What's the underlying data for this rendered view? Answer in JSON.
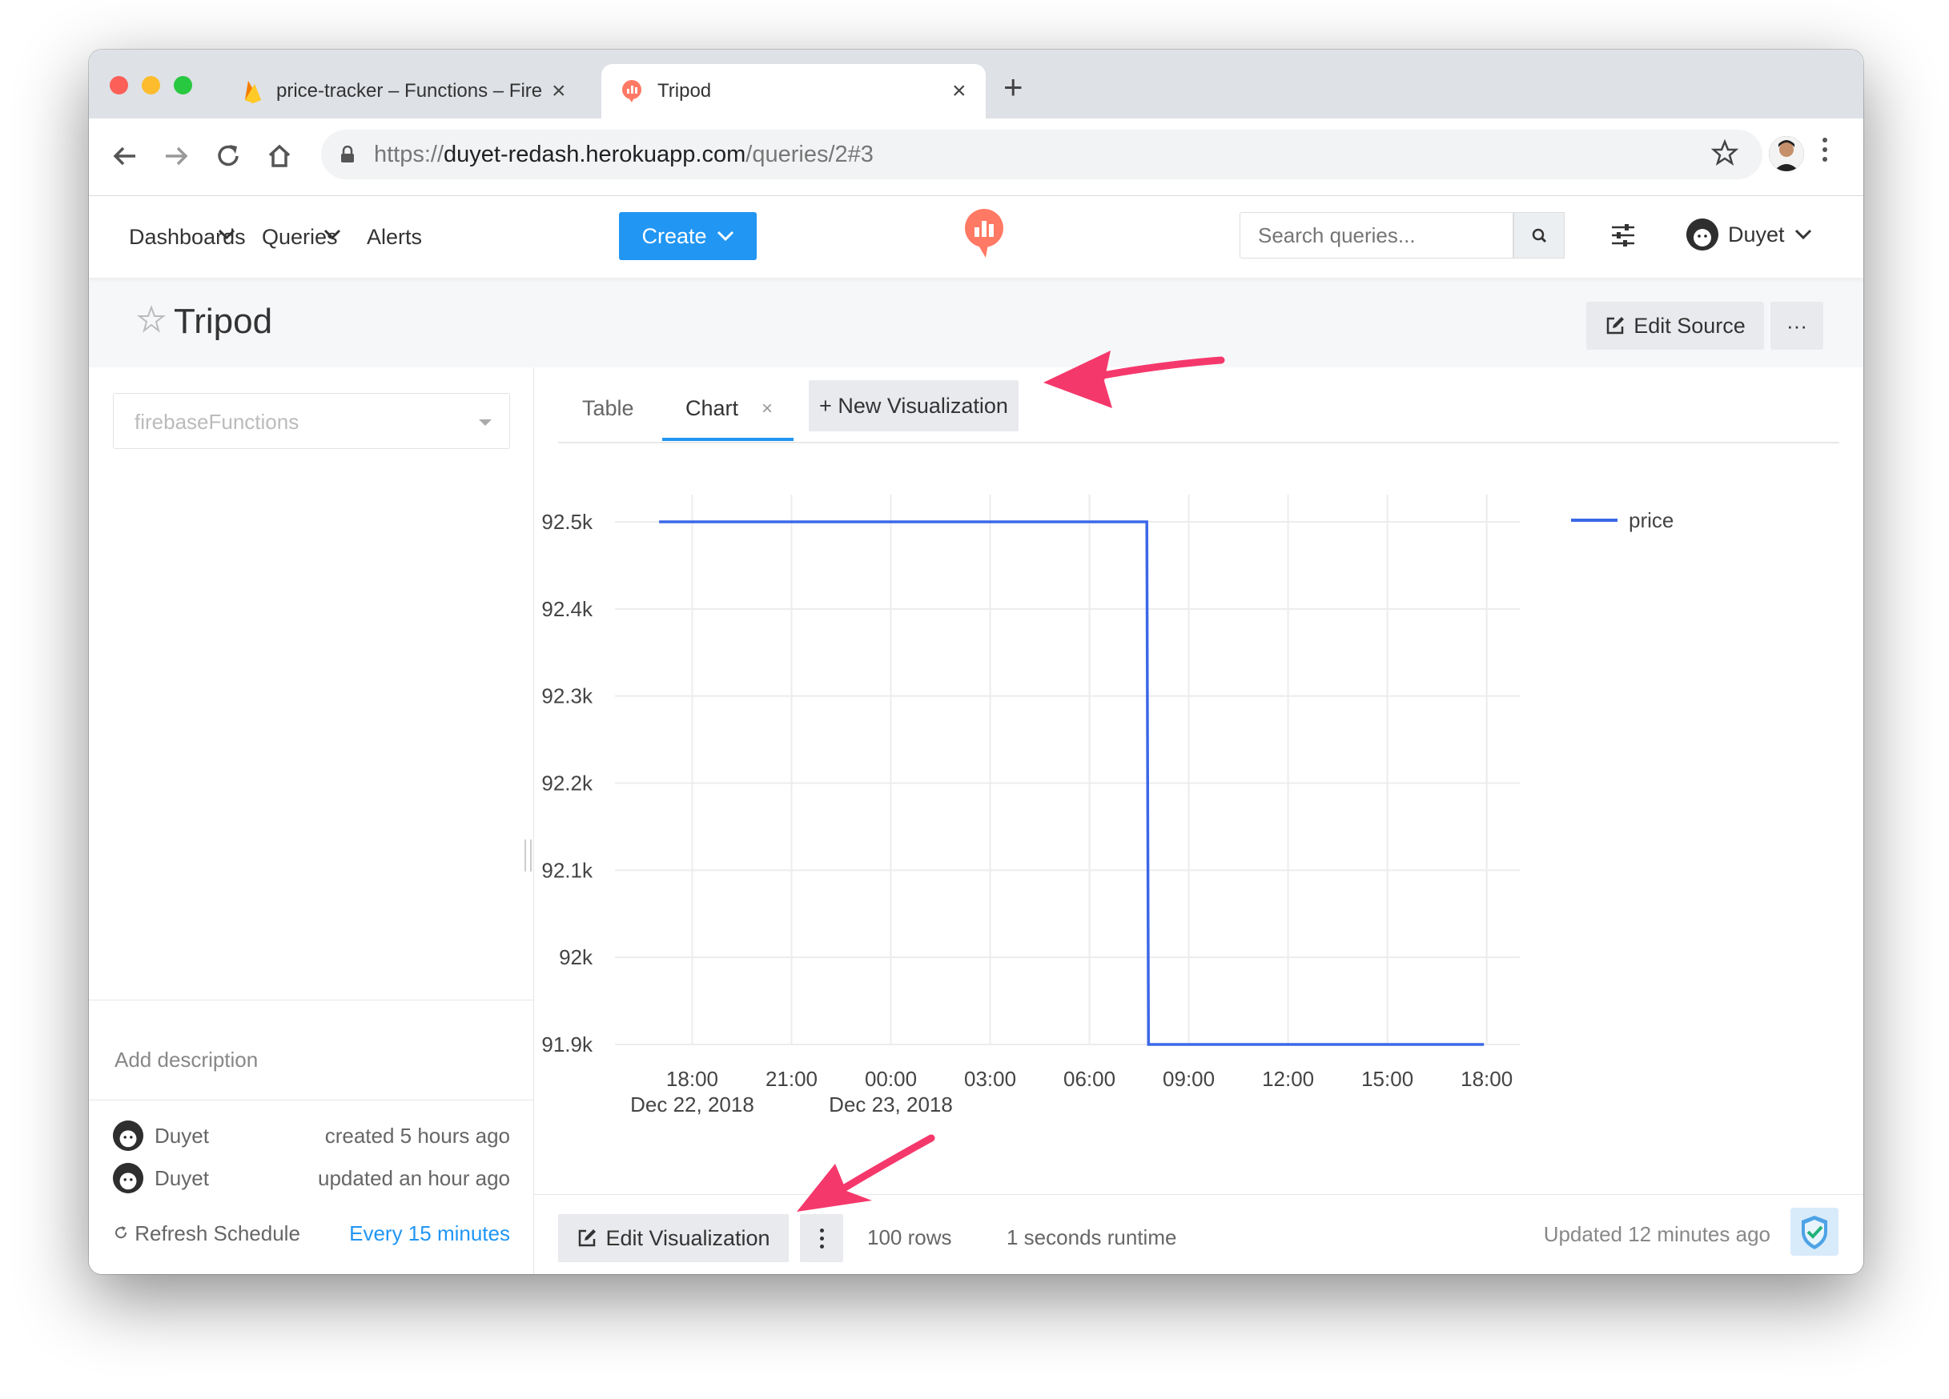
{
  "browser": {
    "tabs": [
      {
        "title": "price-tracker – Functions – Fire",
        "close": "×"
      },
      {
        "title": "Tripod",
        "close": "×"
      }
    ],
    "new_tab": "+",
    "url_scheme": "https://",
    "url_host": "duyet-redash.herokuapp.com",
    "url_path": "/queries/2#3"
  },
  "header": {
    "nav": [
      {
        "label": "Dashboards"
      },
      {
        "label": "Queries"
      },
      {
        "label": "Alerts"
      }
    ],
    "create_label": "Create",
    "search_placeholder": "Search queries...",
    "user_name": "Duyet"
  },
  "query": {
    "title": "Tripod",
    "edit_source_label": "Edit Source",
    "more_label": "···"
  },
  "sidebar": {
    "data_source": "firebaseFunctions",
    "add_description": "Add description",
    "created_by": "Duyet",
    "created_text": "created 5 hours ago",
    "updated_by": "Duyet",
    "updated_text": "updated an hour ago",
    "refresh_label": "Refresh Schedule",
    "refresh_value": "Every 15 minutes"
  },
  "viz_tabs": {
    "table": "Table",
    "chart": "Chart",
    "chart_close": "×",
    "new_viz": "+ New Visualization"
  },
  "footer": {
    "edit_viz_label": "Edit Visualization",
    "rows_text": "100 rows",
    "runtime_text": "1 seconds runtime",
    "updated_text": "Updated 12 minutes ago"
  },
  "colors": {
    "accent": "#2196f3",
    "series": "#3b68e8",
    "arrow": "#f5386b",
    "logo": "#ff7964"
  },
  "chart_data": {
    "type": "line",
    "series": [
      {
        "name": "price",
        "x": [
          "2018-12-22 17:00",
          "2018-12-23 07:44",
          "2018-12-23 07:47",
          "2018-12-23 17:55"
        ],
        "values": [
          92500,
          92500,
          91900,
          91900
        ]
      }
    ],
    "y_ticks": [
      91900,
      92000,
      92100,
      92200,
      92300,
      92400,
      92500
    ],
    "y_tick_labels": [
      "91.9k",
      "92k",
      "92.1k",
      "92.2k",
      "92.3k",
      "92.4k",
      "92.5k"
    ],
    "ylim": [
      91900,
      92500
    ],
    "x_tick_labels": [
      {
        "time": "18:00",
        "date": "Dec 22, 2018"
      },
      {
        "time": "21:00",
        "date": ""
      },
      {
        "time": "00:00",
        "date": "Dec 23, 2018"
      },
      {
        "time": "03:00",
        "date": ""
      },
      {
        "time": "06:00",
        "date": ""
      },
      {
        "time": "09:00",
        "date": ""
      },
      {
        "time": "12:00",
        "date": ""
      },
      {
        "time": "15:00",
        "date": ""
      },
      {
        "time": "18:00",
        "date": ""
      }
    ],
    "xlim": [
      "2018-12-22 15:40",
      "2018-12-23 19:00"
    ],
    "legend": "top-right",
    "grid": true
  }
}
